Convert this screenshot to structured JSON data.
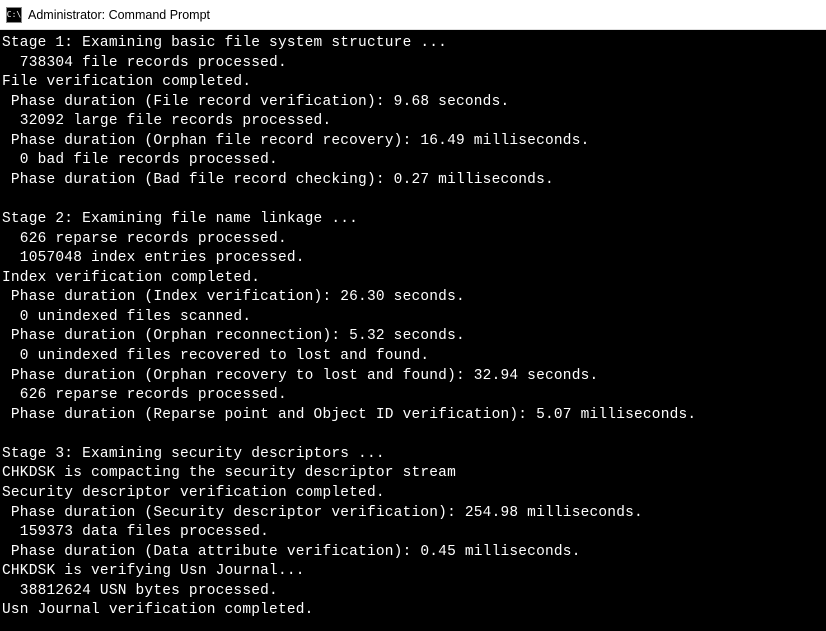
{
  "window": {
    "title": "Administrator: Command Prompt",
    "icon_glyph": "C:\\"
  },
  "lines": [
    "Stage 1: Examining basic file system structure ...",
    "  738304 file records processed.",
    "File verification completed.",
    " Phase duration (File record verification): 9.68 seconds.",
    "  32092 large file records processed.",
    " Phase duration (Orphan file record recovery): 16.49 milliseconds.",
    "  0 bad file records processed.",
    " Phase duration (Bad file record checking): 0.27 milliseconds.",
    "",
    "Stage 2: Examining file name linkage ...",
    "  626 reparse records processed.",
    "  1057048 index entries processed.",
    "Index verification completed.",
    " Phase duration (Index verification): 26.30 seconds.",
    "  0 unindexed files scanned.",
    " Phase duration (Orphan reconnection): 5.32 seconds.",
    "  0 unindexed files recovered to lost and found.",
    " Phase duration (Orphan recovery to lost and found): 32.94 seconds.",
    "  626 reparse records processed.",
    " Phase duration (Reparse point and Object ID verification): 5.07 milliseconds.",
    "",
    "Stage 3: Examining security descriptors ...",
    "CHKDSK is compacting the security descriptor stream",
    "Security descriptor verification completed.",
    " Phase duration (Security descriptor verification): 254.98 milliseconds.",
    "  159373 data files processed.",
    " Phase duration (Data attribute verification): 0.45 milliseconds.",
    "CHKDSK is verifying Usn Journal...",
    "  38812624 USN bytes processed.",
    "Usn Journal verification completed."
  ]
}
